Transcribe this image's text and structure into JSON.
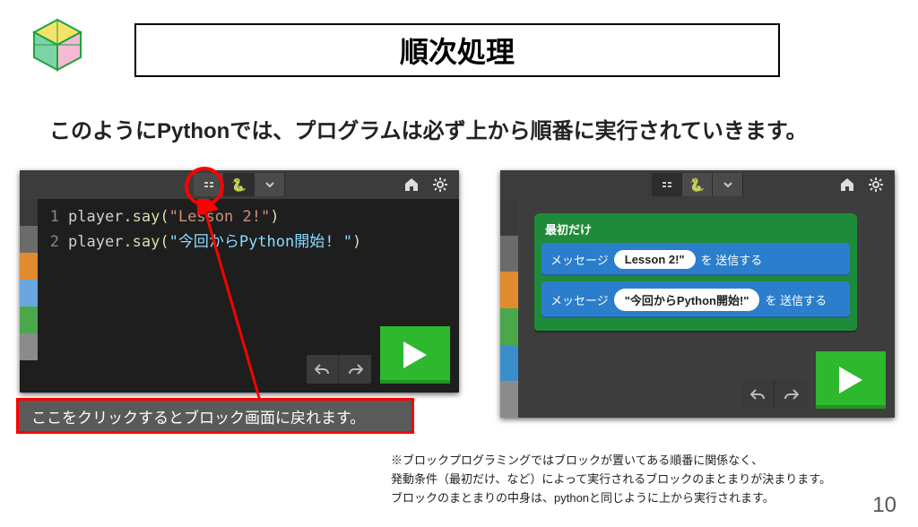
{
  "page": {
    "title": "順次処理",
    "intro": "このようにPythonでは、プログラムは必ず上から順番に実行されていきます。",
    "tooltip": "ここをクリックするとブロック画面に戻れます。",
    "footnote_line1": "※ブロックプログラミングではブロックが置いてある順番に関係なく、",
    "footnote_line2": "発動条件（最初だけ、など）によって実行されるブロックのまとまりが決まります。",
    "footnote_line3": "ブロックのまとまりの中身は、pythonと同じように上から実行されます。",
    "page_number": "10"
  },
  "code": {
    "line1_no": "1",
    "line1_id": "player",
    "line1_call": ".say(",
    "line1_str": "\"Lesson 2!\"",
    "line1_close": ")",
    "line2_no": "2",
    "line2_id": "player",
    "line2_call": ".say(",
    "line2_str": "\"今回からPython開始! \"",
    "line2_close": ")"
  },
  "blocks": {
    "hat_title": "最初だけ",
    "msg_label": "メッセージ",
    "msg_suffix": "を 送信する",
    "pill1": "Lesson 2!\"",
    "pill2": "\"今回からPython開始!\""
  },
  "colors": {
    "side": [
      "#3a3a3a",
      "#6b6b6b",
      "#e08b2e",
      "#6ba6e0",
      "#4aa84a",
      "#8b8b8b"
    ],
    "side2": [
      "#3a3a3a",
      "#6b6b6b",
      "#e08b2e",
      "#4aa84a",
      "#3a8ecb",
      "#8b8b8b"
    ]
  }
}
